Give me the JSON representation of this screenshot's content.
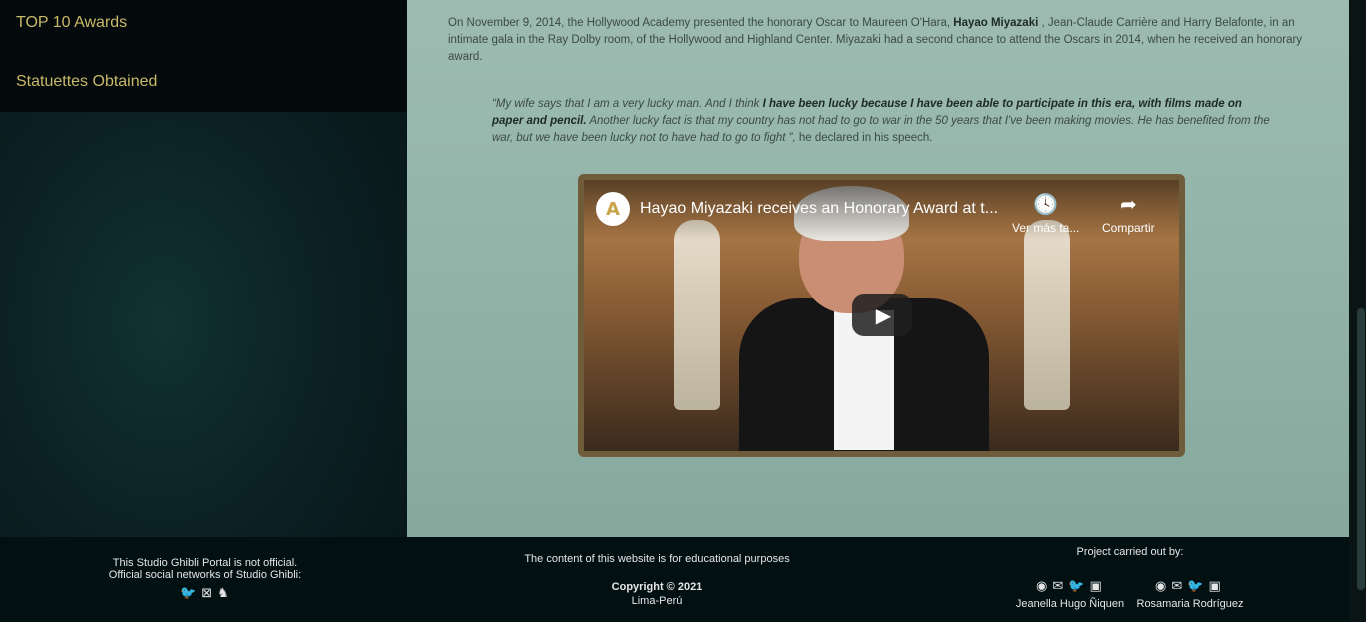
{
  "sidebar": {
    "items": [
      {
        "label": "TOP 10 Awards"
      },
      {
        "label": "Statuettes Obtained"
      }
    ]
  },
  "article": {
    "p1_a": "On November 9, 2014, the Hollywood Academy presented the honorary Oscar to Maureen O'Hara, ",
    "p1_bold": "Hayao Miyazaki",
    "p1_b": " , Jean-Claude Carrière and Harry Belafonte, in an intimate gala in the Ray Dolby room, of the Hollywood and Highland Center. Miyazaki had a second chance to attend the Oscars in 2014, when he received an honorary award.",
    "q_a": "“My wife says that I am a very lucky man. And I think ",
    "q_bold": "I have been lucky because I have been able to participate in this era, with films made on paper and pencil.",
    "q_b": " Another lucky fact is that my country has not had to go to war in the 50 years that I've been making movies. He has benefited from the war, but we have been lucky not to have had to go to fight ”,",
    "q_c": " he declared in his speech."
  },
  "video": {
    "title": "Hayao Miyazaki receives an Honorary Award at t...",
    "channel_logo": "A",
    "watch_later": "Ver más ta...",
    "share": "Compartir"
  },
  "footer": {
    "left_line1": "This Studio Ghibli Portal is not official.",
    "left_line2": "Official social networks of Studio Ghibli:",
    "center_line1": "The content of this website is for educational purposes",
    "copyright": "Copyright © 2021",
    "location": "Lima-Perú",
    "project_label": "Project carried out by:",
    "author1": "Jeanella Hugo Ñiquen",
    "author2": "Rosamaria Rodríguez"
  },
  "icons": {
    "left_social": [
      "twitter-icon",
      "ghibli-icon",
      "totoro-icon"
    ],
    "author_social": [
      "github-icon",
      "mail-icon",
      "twitter-icon",
      "linkedin-icon"
    ]
  }
}
